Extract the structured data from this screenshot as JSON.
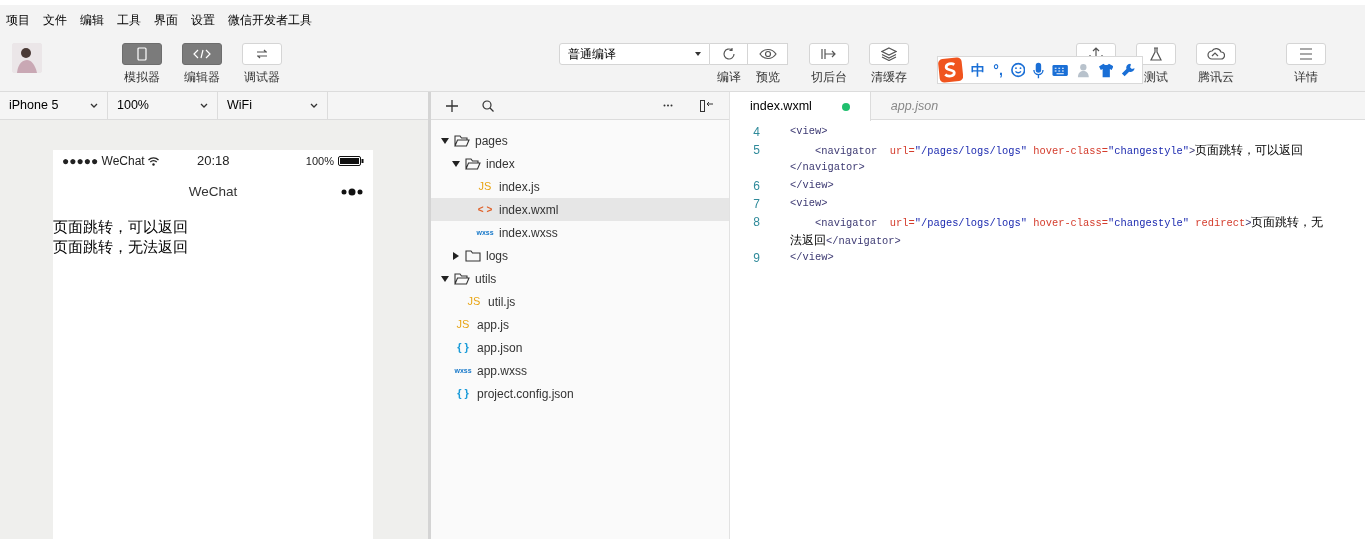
{
  "menu": [
    "项目",
    "文件",
    "编辑",
    "工具",
    "界面",
    "设置",
    "微信开发者工具"
  ],
  "toolbar": {
    "modes": [
      {
        "label": "模拟器",
        "kind": "phone",
        "selected": true
      },
      {
        "label": "编辑器",
        "kind": "code",
        "selected": true
      },
      {
        "label": "调试器",
        "kind": "swap",
        "selected": false
      }
    ],
    "compile_mode": "普通编译",
    "actions": [
      {
        "label": "编译",
        "kind": "refresh"
      },
      {
        "label": "预览",
        "kind": "eye"
      }
    ],
    "more": [
      {
        "label": "切后台",
        "kind": "background"
      },
      {
        "label": "清缓存",
        "kind": "layers"
      }
    ],
    "right": [
      {
        "kind": "upload"
      },
      {
        "label": "测试",
        "kind": "flask"
      },
      {
        "label": "腾讯云",
        "kind": "cloud"
      },
      {
        "label": "详情",
        "kind": "menu"
      }
    ]
  },
  "ime": {
    "mode": "中",
    "punct": "°,"
  },
  "simulator": {
    "device": "iPhone 5",
    "zoom": "100%",
    "network": "WiFi",
    "status": {
      "carrier": "●●●●● WeChat",
      "time": "20:18",
      "battery": "100%"
    },
    "nav_title": "WeChat",
    "lines": [
      "页面跳转，可以返回",
      "页面跳转，无法返回"
    ]
  },
  "explorer": {
    "tree": [
      {
        "kind": "folder",
        "name": "pages",
        "expanded": true,
        "selected": false,
        "children": [
          {
            "kind": "folder",
            "name": "index",
            "expanded": true,
            "selected": false,
            "children": [
              {
                "kind": "js",
                "badge": "JS",
                "name": "index.js",
                "selected": false
              },
              {
                "kind": "wxml",
                "badge": "< >",
                "name": "index.wxml",
                "selected": true
              },
              {
                "kind": "wxss",
                "badge": "wxss",
                "name": "index.wxss",
                "selected": false
              }
            ]
          },
          {
            "kind": "folder",
            "name": "logs",
            "expanded": false,
            "selected": false
          }
        ]
      },
      {
        "kind": "folder",
        "name": "utils",
        "expanded": true,
        "selected": false,
        "children": [
          {
            "kind": "js",
            "badge": "JS",
            "name": "util.js",
            "selected": false
          }
        ]
      },
      {
        "kind": "js",
        "badge": "JS",
        "name": "app.js",
        "selected": false
      },
      {
        "kind": "json",
        "badge": "{ }",
        "name": "app.json",
        "selected": false
      },
      {
        "kind": "wxss",
        "badge": "wxss",
        "name": "app.wxss",
        "selected": false
      },
      {
        "kind": "json",
        "badge": "{ }",
        "name": "project.config.json",
        "selected": false
      }
    ]
  },
  "tabs": [
    {
      "label": "index.wxml",
      "selected": true,
      "modified": true,
      "preview": false
    },
    {
      "label": "app.json",
      "selected": false,
      "modified": false,
      "preview": true
    }
  ],
  "code": [
    {
      "number": "4",
      "rows": [
        [
          {
            "kind": "tag",
            "text": "<view>"
          }
        ]
      ]
    },
    {
      "number": "5",
      "rows": [
        [
          {
            "kind": "tag",
            "text": "    <navigator"
          },
          {
            "kind": "attr",
            "text": "  url="
          },
          {
            "kind": "string",
            "text": "\"/pages/logs/logs\""
          },
          {
            "kind": "attr",
            "text": " hover-class="
          },
          {
            "kind": "string",
            "text": "\"changestyle\""
          },
          {
            "kind": "tag",
            "text": ">"
          },
          {
            "kind": "text",
            "text": "页面跳转，可以返回"
          }
        ],
        [
          {
            "kind": "tag",
            "text": "</navigator>"
          }
        ]
      ]
    },
    {
      "number": "6",
      "rows": [
        [
          {
            "kind": "tag",
            "text": "</view>"
          }
        ]
      ]
    },
    {
      "number": "7",
      "rows": [
        [
          {
            "kind": "tag",
            "text": "<view>"
          }
        ]
      ]
    },
    {
      "number": "8",
      "rows": [
        [
          {
            "kind": "tag",
            "text": "    <navigator"
          },
          {
            "kind": "attr",
            "text": "  url="
          },
          {
            "kind": "string",
            "text": "\"/pages/logs/logs\""
          },
          {
            "kind": "attr",
            "text": " hover-class="
          },
          {
            "kind": "string",
            "text": "\"changestyle\""
          },
          {
            "kind": "attr",
            "text": " redirect"
          },
          {
            "kind": "tag",
            "text": ">"
          },
          {
            "kind": "text",
            "text": "页面跳转，无"
          }
        ],
        [
          {
            "kind": "text",
            "text": "法返回"
          },
          {
            "kind": "tag",
            "text": "</navigator>"
          }
        ]
      ]
    },
    {
      "number": "9",
      "rows": [
        [
          {
            "kind": "tag",
            "text": "</view>"
          }
        ]
      ]
    }
  ]
}
